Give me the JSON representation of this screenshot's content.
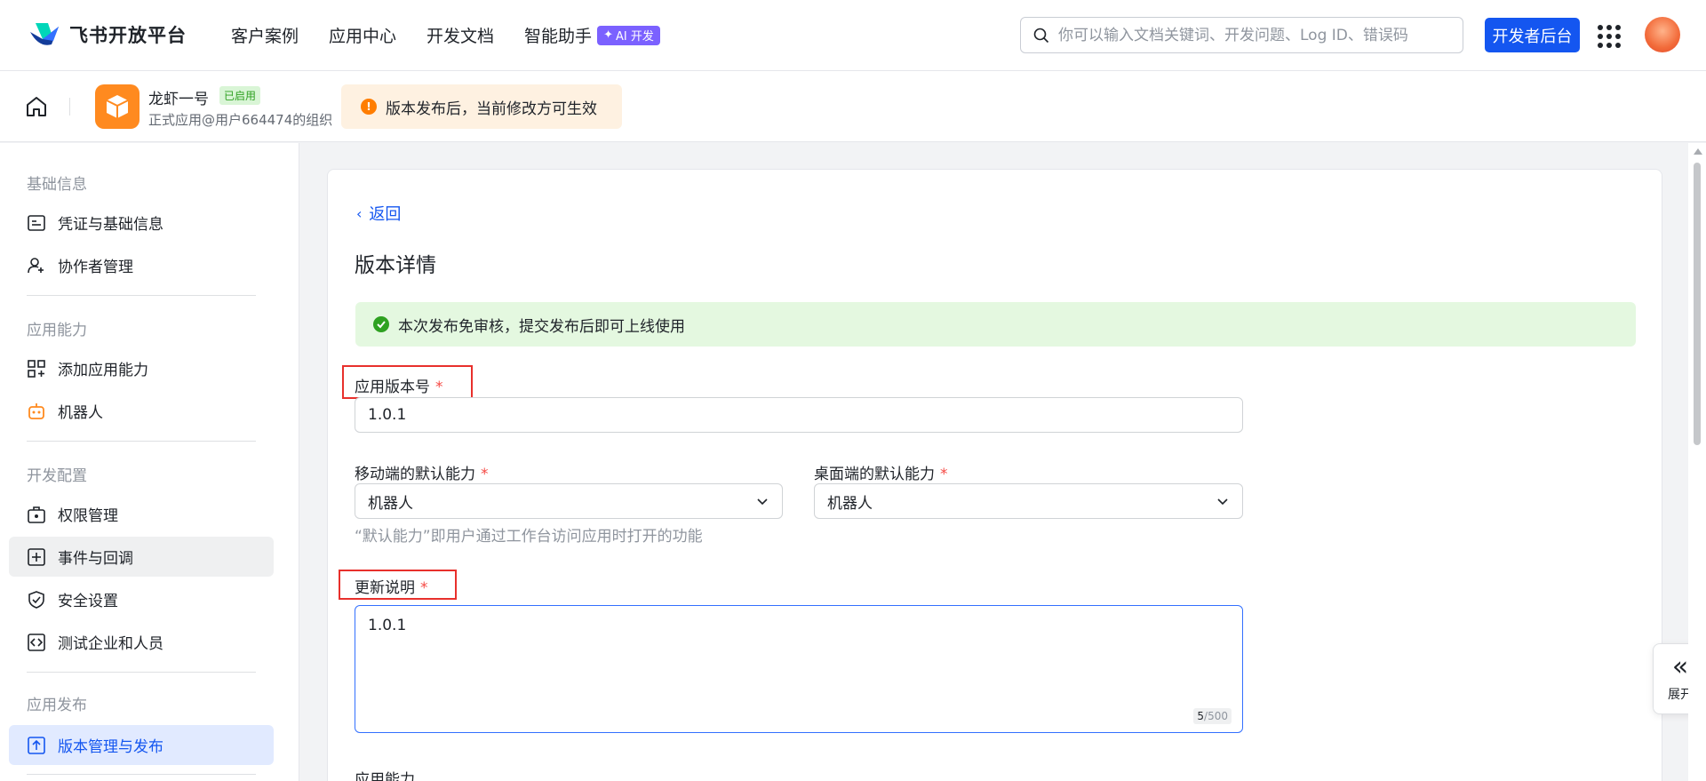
{
  "topnav": {
    "brand": "飞书开放平台",
    "links": [
      "客户案例",
      "应用中心",
      "开发文档",
      "智能助手"
    ],
    "ai_badge": "AI 开发",
    "search_placeholder": "你可以输入文档关键词、开发问题、Log ID、错误码",
    "dev_console_label": "开发者后台"
  },
  "appbar": {
    "app_name": "龙虾一号",
    "app_status": "已启用",
    "app_org": "正式应用@用户664474的组织",
    "notice": "版本发布后，当前修改方可生效"
  },
  "sidebar": {
    "sections": [
      {
        "title": "基础信息",
        "items": [
          "凭证与基础信息",
          "协作者管理"
        ]
      },
      {
        "title": "应用能力",
        "items": [
          "添加应用能力",
          "机器人"
        ]
      },
      {
        "title": "开发配置",
        "items": [
          "权限管理",
          "事件与回调",
          "安全设置",
          "测试企业和人员"
        ]
      },
      {
        "title": "应用发布",
        "items": [
          "版本管理与发布"
        ]
      }
    ]
  },
  "main": {
    "back_label": "返回",
    "title": "版本详情",
    "success_banner": "本次发布免审核，提交发布后即可上线使用",
    "version_label": "应用版本号",
    "version_value": "1.0.1",
    "mobile_default_label": "移动端的默认能力",
    "mobile_default_value": "机器人",
    "desktop_default_label": "桌面端的默认能力",
    "desktop_default_value": "机器人",
    "default_hint": "“默认能力”即用户通过工作台访问应用时打开的功能",
    "update_notes_label": "更新说明",
    "update_notes_value": "1.0.1",
    "update_notes_count": "5",
    "update_notes_max": "/500",
    "required_mark": "*",
    "next_section_label": "应用能力"
  },
  "expand_panel": {
    "label": "展开",
    "glyph": "«"
  }
}
